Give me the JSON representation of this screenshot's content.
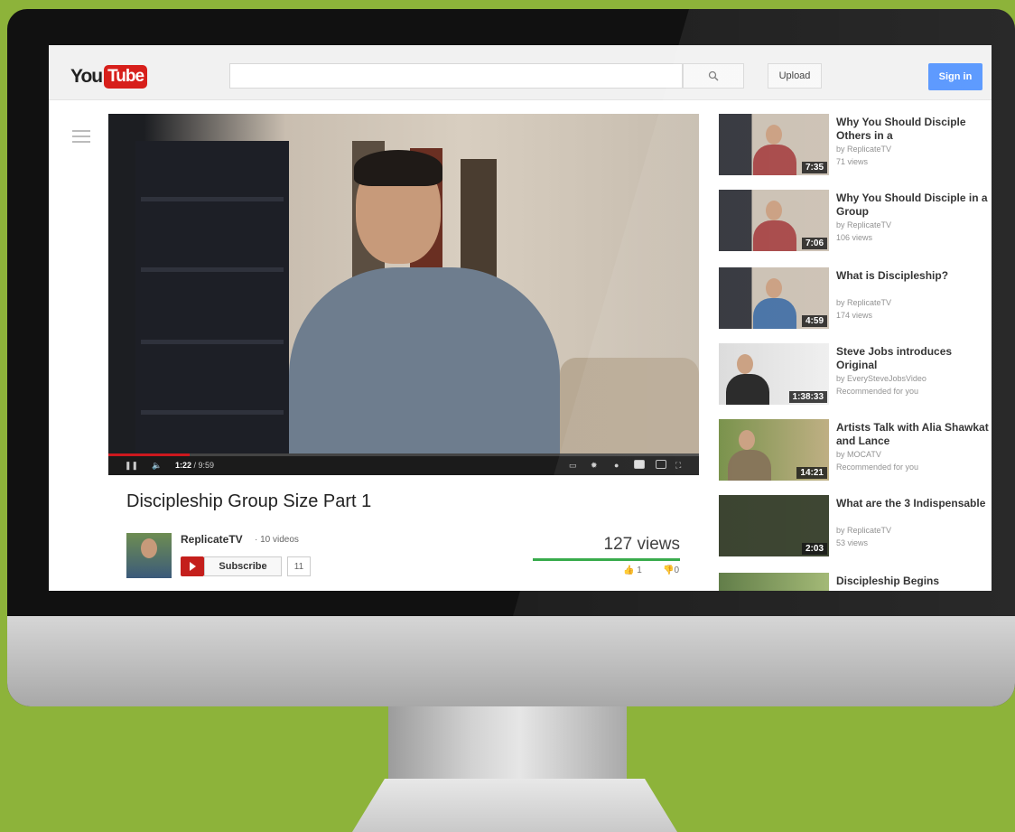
{
  "masthead": {
    "logo_you": "You",
    "logo_tube": "Tube",
    "search_placeholder": "",
    "upload_label": "Upload",
    "signin_label": "Sign in"
  },
  "player": {
    "current_time": "1:22",
    "duration": "9:59",
    "progress_fraction": 0.137
  },
  "video": {
    "title": "Discipleship Group Size Part 1",
    "channel": "ReplicateTV",
    "video_count": "· 10 videos",
    "subscribe_label": "Subscribe",
    "subscriber_count": "11",
    "views": "127 views",
    "likes": "1",
    "dislikes": "0"
  },
  "sidebar": {
    "items": [
      {
        "title": "Why You Should Disciple Others in a",
        "by": "by ReplicateTV",
        "meta": "71 views",
        "duration": "7:35"
      },
      {
        "title": "Why You Should Disciple in a Group",
        "by": "by ReplicateTV",
        "meta": "106 views",
        "duration": "7:06"
      },
      {
        "title": "What is Discipleship?",
        "by": "by ReplicateTV",
        "meta": "174 views",
        "duration": "4:59"
      },
      {
        "title": "Steve Jobs introduces Original",
        "by": "by EverySteveJobsVideo",
        "meta": "Recommended for you",
        "duration": "1:38:33"
      },
      {
        "title": "Artists Talk with Alia Shawkat and Lance",
        "by": "by MOCATV",
        "meta": "Recommended for you",
        "duration": "14:21"
      },
      {
        "title": "What are the 3 Indispensable",
        "by": "by ReplicateTV",
        "meta": "53 views",
        "duration": "2:03"
      },
      {
        "title": "Discipleship Begins",
        "by": "",
        "meta": "",
        "duration": ""
      }
    ]
  },
  "colors": {
    "background": "#8db33a",
    "youtube_red": "#d71f1b",
    "signin_blue": "#4d90fe",
    "views_bar": "#2ba640"
  }
}
